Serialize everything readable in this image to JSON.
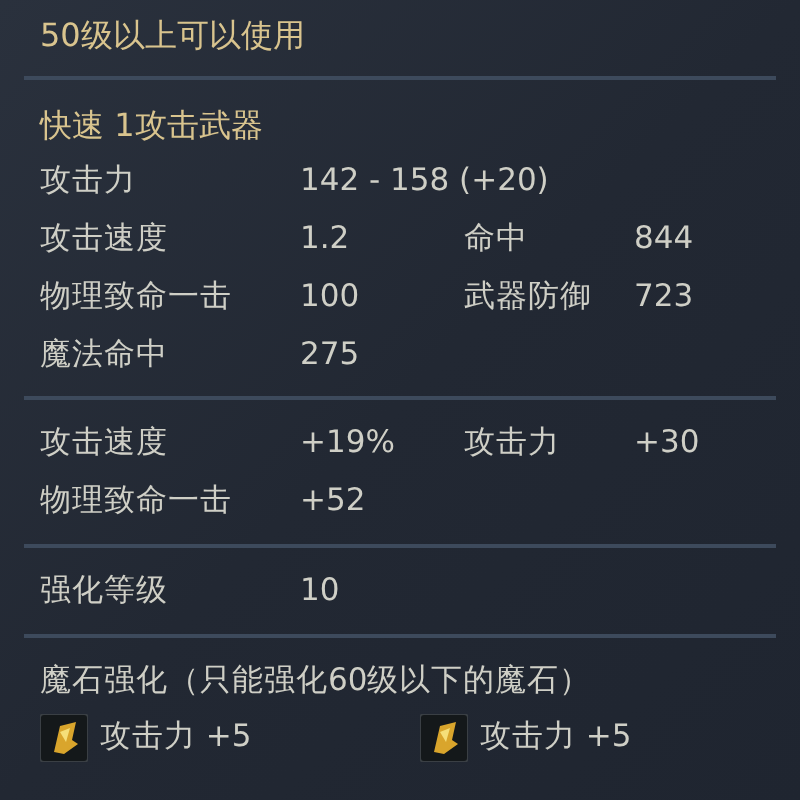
{
  "requirement": "50级以上可以使用",
  "weapon_type": "快速 1攻击武器",
  "sections": [
    {
      "rows": [
        [
          {
            "label": "攻击力",
            "value": "142 - 158 (+20)"
          }
        ],
        [
          {
            "label": "攻击速度",
            "value": "1.2"
          },
          {
            "label": "命中",
            "value": "844"
          }
        ],
        [
          {
            "label": "物理致命一击",
            "value": "100"
          },
          {
            "label": "武器防御",
            "value": "723"
          }
        ],
        [
          {
            "label": "魔法命中",
            "value": "275"
          }
        ]
      ]
    },
    {
      "rows": [
        [
          {
            "label": "攻击速度",
            "value": "+19%"
          },
          {
            "label": "攻击力",
            "value": "+30"
          }
        ],
        [
          {
            "label": "物理致命一击",
            "value": "+52"
          }
        ]
      ]
    },
    {
      "rows": [
        [
          {
            "label": "强化等级",
            "value": "10"
          }
        ]
      ]
    }
  ],
  "manastone_heading": "魔石强化（只能强化60级以下的魔石）",
  "manastones": [
    {
      "text": "攻击力 +5"
    },
    {
      "text": "攻击力 +5"
    }
  ]
}
